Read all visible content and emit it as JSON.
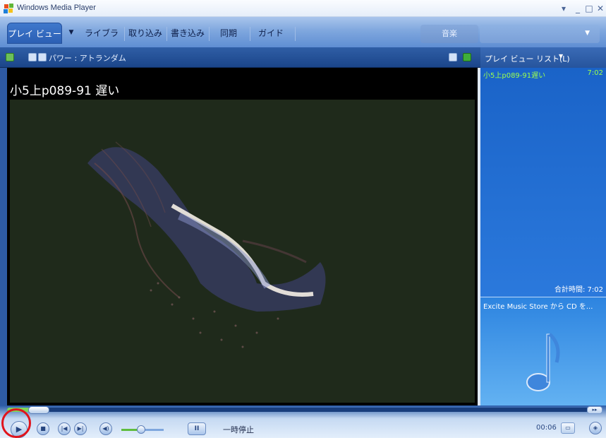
{
  "window": {
    "title": "Windows Media Player"
  },
  "tabs": [
    {
      "label": "プレイ ビュー"
    },
    {
      "label": "ライブラリ"
    },
    {
      "label": "取り込み"
    },
    {
      "label": "書き込み"
    },
    {
      "label": "同期"
    },
    {
      "label": "ガイド"
    }
  ],
  "music_tab": {
    "label": "音楽"
  },
  "now_playing": {
    "visualization": "パワー : アトランダム"
  },
  "video": {
    "title": "小5上p089-91 遅い"
  },
  "playlist": {
    "header": "プレイ ビュー リスト(L)",
    "items": [
      {
        "name": "小5上p089-91遅い",
        "time": "7:02"
      }
    ],
    "total": "合計時間: 7:02"
  },
  "store": {
    "text": "Excite Music Store から CD を..."
  },
  "transport": {
    "status": "一時停止",
    "time": "00:06",
    "seek_fraction": 0.06,
    "volume_fraction": 0.45
  },
  "colors": {
    "accent": "#2b5fb4",
    "playlist_text": "#9cff4c",
    "highlight": "#e0141c"
  }
}
